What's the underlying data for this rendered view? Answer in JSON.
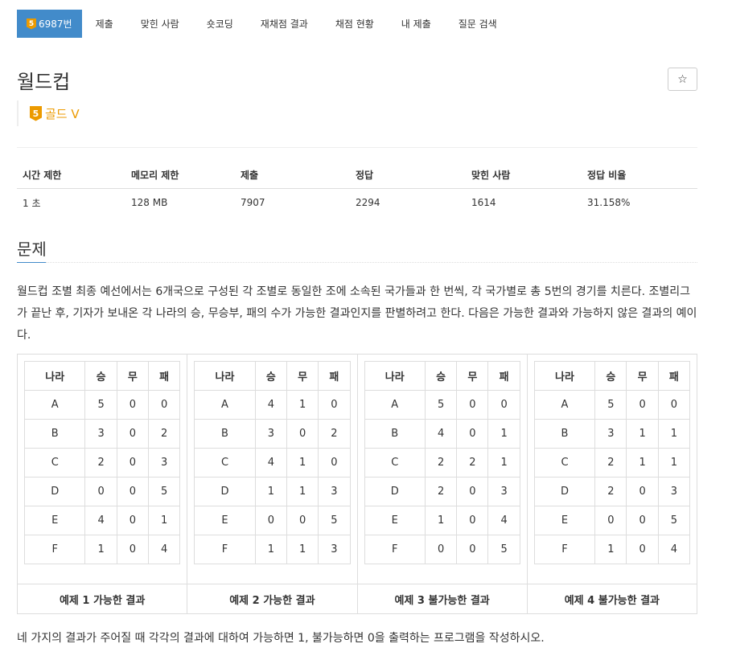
{
  "nav": {
    "tier_number": "5",
    "problem_id": "6987번",
    "items": [
      "제출",
      "맞힌 사람",
      "숏코딩",
      "재채점 결과",
      "채점 현황",
      "내 제출",
      "질문 검색"
    ]
  },
  "title": "월드컵",
  "star_icon": "☆",
  "tier": {
    "number": "5",
    "label": "골드 V",
    "color": "#ec9a00"
  },
  "info": {
    "headers": [
      "시간 제한",
      "메모리 제한",
      "제출",
      "정답",
      "맞힌 사람",
      "정답 비율"
    ],
    "values": [
      "1 초",
      "128 MB",
      "7907",
      "2294",
      "1614",
      "31.158%"
    ]
  },
  "section_title": "문제",
  "description": "월드컵 조별 최종 예선에서는 6개국으로 구성된 각 조별로 동일한 조에 소속된 국가들과 한 번씩, 각 국가별로 총 5번의 경기를 치른다. 조별리그가 끝난 후, 기자가 보내온 각 나라의 승, 무승부, 패의 수가 가능한 결과인지를 판별하려고 한다. 다음은 가능한 결과와 가능하지 않은 결과의 예이다.",
  "examples": {
    "headers": [
      "나라",
      "승",
      "무",
      "패"
    ],
    "items": [
      {
        "caption": "예제 1 가능한 결과",
        "rows": [
          [
            "A",
            "5",
            "0",
            "0"
          ],
          [
            "B",
            "3",
            "0",
            "2"
          ],
          [
            "C",
            "2",
            "0",
            "3"
          ],
          [
            "D",
            "0",
            "0",
            "5"
          ],
          [
            "E",
            "4",
            "0",
            "1"
          ],
          [
            "F",
            "1",
            "0",
            "4"
          ]
        ]
      },
      {
        "caption": "예제 2 가능한 결과",
        "rows": [
          [
            "A",
            "4",
            "1",
            "0"
          ],
          [
            "B",
            "3",
            "0",
            "2"
          ],
          [
            "C",
            "4",
            "1",
            "0"
          ],
          [
            "D",
            "1",
            "1",
            "3"
          ],
          [
            "E",
            "0",
            "0",
            "5"
          ],
          [
            "F",
            "1",
            "1",
            "3"
          ]
        ]
      },
      {
        "caption": "예제 3 불가능한 결과",
        "rows": [
          [
            "A",
            "5",
            "0",
            "0"
          ],
          [
            "B",
            "4",
            "0",
            "1"
          ],
          [
            "C",
            "2",
            "2",
            "1"
          ],
          [
            "D",
            "2",
            "0",
            "3"
          ],
          [
            "E",
            "1",
            "0",
            "4"
          ],
          [
            "F",
            "0",
            "0",
            "5"
          ]
        ]
      },
      {
        "caption": "예제 4 불가능한 결과",
        "rows": [
          [
            "A",
            "5",
            "0",
            "0"
          ],
          [
            "B",
            "3",
            "1",
            "1"
          ],
          [
            "C",
            "2",
            "1",
            "1"
          ],
          [
            "D",
            "2",
            "0",
            "3"
          ],
          [
            "E",
            "0",
            "0",
            "5"
          ],
          [
            "F",
            "1",
            "0",
            "4"
          ]
        ]
      }
    ]
  },
  "footer": "네 가지의 결과가 주어질 때 각각의 결과에 대하여 가능하면 1, 불가능하면 0을 출력하는 프로그램을 작성하시오."
}
